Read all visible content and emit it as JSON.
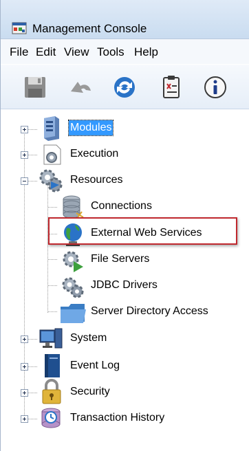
{
  "window": {
    "title": "Management Console"
  },
  "menu": [
    "File",
    "Edit",
    "View",
    "Tools",
    "Help"
  ],
  "toolbar": [
    "save-icon",
    "undo-icon",
    "refresh-icon",
    "clipboard-icon",
    "info-icon"
  ],
  "tree": {
    "modules": "Modules",
    "execution": "Execution",
    "resources": "Resources",
    "connections": "Connections",
    "external_web_services": "External Web Services",
    "file_servers": "File Servers",
    "jdbc_drivers": "JDBC Drivers",
    "server_directory_access": "Server Directory Access",
    "system": "System",
    "event_log": "Event Log",
    "security": "Security",
    "transaction_history": "Transaction History",
    "selected": "Modules",
    "highlighted": "External Web Services"
  },
  "colors": {
    "selection": "#3399ff",
    "highlight_border": "#c0282e"
  }
}
